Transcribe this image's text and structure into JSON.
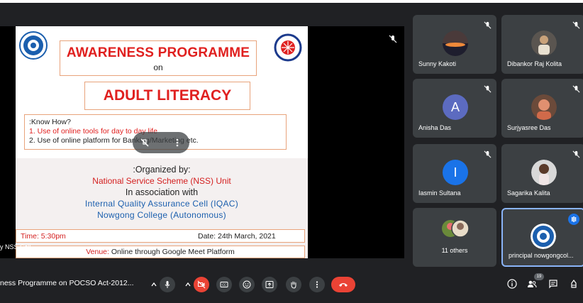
{
  "slide": {
    "title": "AWARENESS PROGRAMME",
    "on": "on",
    "subject": "ADULT LITERACY",
    "know_how": ":Know How?",
    "know_1": "1. Use of online tools for day to day life",
    "know_2": "2. Use of online platform for Banking/Marketing etc.",
    "organized_by": ":Organized by:",
    "nss": "National Service Scheme (NSS) Unit",
    "assoc": "In association with",
    "iqac": "Internal Quality Assurance Cell (IQAC)",
    "college": "Nowgong College (Autonomous)",
    "time": "Time: 5:30pm",
    "date": "Date: 24th March, 2021",
    "venue_label": "Venue:",
    "venue": "Online through Google Meet Platform"
  },
  "stage": {
    "presenter_label": "y NSS Cell"
  },
  "participants": [
    {
      "name": "Sunny Kakoti",
      "muted": true,
      "avatar": "photo"
    },
    {
      "name": "Dibankor Raj Kolita",
      "muted": true,
      "avatar": "photo"
    },
    {
      "name": "Anisha Das",
      "muted": true,
      "avatar": "letter",
      "letter": "A",
      "color": "#5c6bc0"
    },
    {
      "name": "Surjyasree Das",
      "muted": true,
      "avatar": "photo"
    },
    {
      "name": "Iasmin Sultana",
      "muted": true,
      "avatar": "letter",
      "letter": "I",
      "color": "#1a73e8"
    },
    {
      "name": "Sagarika Kalita",
      "muted": true,
      "avatar": "photo"
    },
    {
      "name": "11 others",
      "muted": false,
      "avatar": "group"
    },
    {
      "name": "principal nowgongcol...",
      "muted": false,
      "avatar": "logo",
      "speaking": true
    }
  ],
  "bottom_bar": {
    "meeting_title": "ness Programme on POCSO Act-2012...",
    "participant_count": "19"
  },
  "colors": {
    "background": "#202124",
    "tile": "#3c4043",
    "end_call": "#ea4335",
    "accent_red_text": "#e0201f",
    "accent_blue_text": "#1b5fae"
  },
  "icons": [
    "caret-up-icon",
    "microphone-icon",
    "camera-off-icon",
    "captions-icon",
    "emoji-icon",
    "present-icon",
    "raise-hand-icon",
    "more-vert-icon",
    "end-call-icon",
    "info-icon",
    "people-icon",
    "chat-icon",
    "activities-icon",
    "mic-off-icon"
  ]
}
